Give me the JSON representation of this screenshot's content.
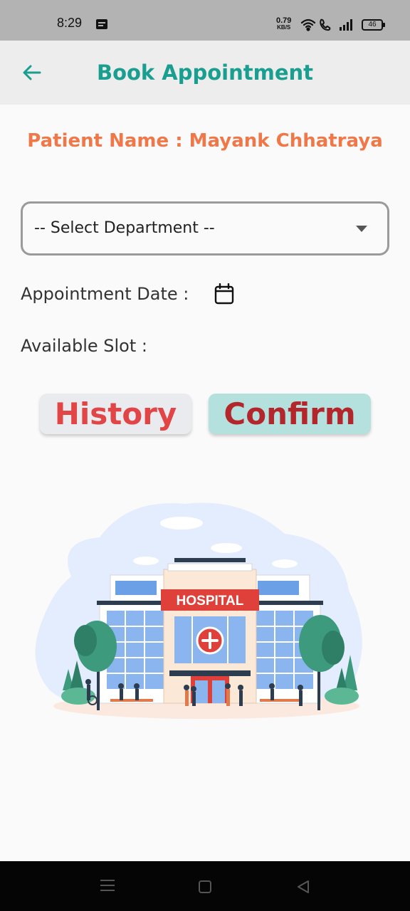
{
  "status_bar": {
    "time": "8:29",
    "net_speed": "0.79",
    "net_unit": "KB/S",
    "battery": "46"
  },
  "app_bar": {
    "title": "Book Appointment",
    "back_icon": "arrow-left-icon"
  },
  "patient": {
    "label": "Patient Name : Mayank Chhatraya"
  },
  "form": {
    "department_select": "-- Select Department --",
    "appointment_date_label": "Appointment Date :",
    "available_slot_label": "Available Slot :"
  },
  "buttons": {
    "history": "History",
    "confirm": "Confirm"
  },
  "illustration": {
    "sign": "HOSPITAL"
  },
  "colors": {
    "accent": "#1a9e90",
    "patient_name": "#f07848",
    "history_text": "#e14545",
    "confirm_text": "#b3262b",
    "confirm_bg": "#b4e1de"
  }
}
